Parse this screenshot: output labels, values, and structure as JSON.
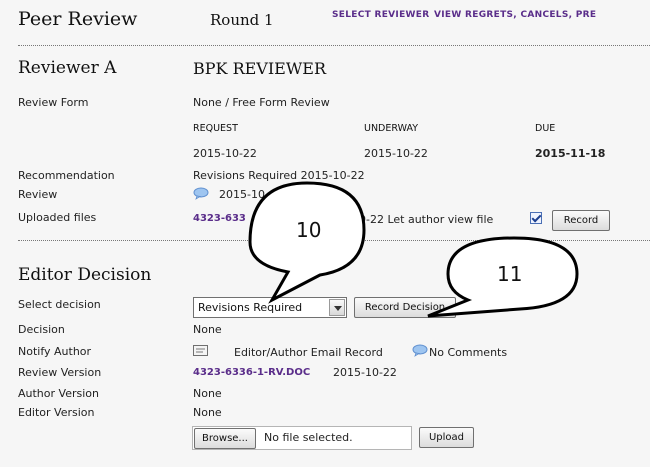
{
  "header": {
    "title": "Peer Review",
    "round": "Round 1",
    "links": [
      "SELECT REVIEWER",
      "VIEW REGRETS, CANCELS, PRE"
    ]
  },
  "reviewer": {
    "heading": "Reviewer A",
    "name": "BPK REVIEWER",
    "form_label": "Review Form",
    "form_value": "None / Free Form Review",
    "col_request": "REQUEST",
    "col_underway": "UNDERWAY",
    "col_due": "DUE",
    "request_date": "2015-10-22",
    "underway_date": "2015-10-22",
    "due_date": "2015-11-18",
    "recommendation_label": "Recommendation",
    "recommendation_value": "Revisions Required  2015-10-22",
    "review_label": "Review",
    "review_date": "2015-10-",
    "uploaded_label": "Uploaded files",
    "uploaded_file": "4323-633",
    "uploaded_tail": "10-22 Let author view file",
    "record_label": "Record"
  },
  "editor": {
    "heading": "Editor Decision",
    "select_label": "Select decision",
    "select_value": "Revisions Required",
    "record_decision_label": "Record Decision",
    "decision_label": "Decision",
    "decision_value": "None",
    "notify_label": "Notify Author",
    "notify_text": "Editor/Author Email Record",
    "no_comments": "No Comments",
    "review_version_label": "Review Version",
    "review_version_file": "4323-6336-1-RV.DOC",
    "review_version_date": "2015-10-22",
    "author_version_label": "Author Version",
    "author_version_value": "None",
    "editor_version_label": "Editor Version",
    "editor_version_value": "None",
    "browse_label": "Browse...",
    "no_file_text": "No file selected.",
    "upload_label": "Upload"
  },
  "callouts": [
    "10",
    "11"
  ],
  "colors": {
    "link": "#5a2d8a",
    "due": "#6b1ea8"
  }
}
